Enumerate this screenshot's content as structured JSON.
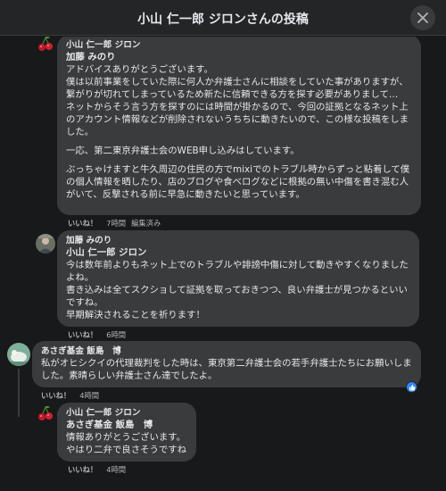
{
  "header": {
    "title": "小山 仁一郎 ジロンさんの投稿"
  },
  "comments": [
    {
      "author": "小山 仁一郎 ジロン",
      "mention": "加藤 みのり",
      "lines": [
        "アドバイスありがとうございます。",
        "僕は以前事業をしていた際に何人か弁護士さんに相談をしていた事がありますが、繋がりが切れてしまっているため新たに信頼できる方を探す必要がありまして…",
        "ネットからそう言う方を探すのには時間が掛かるので、今回の証拠となるネット上のアカウント情報などが削除されないうちちに動きたいので、この様な投稿をしました。",
        "一応、第二東京弁護士会のWEB申し込みはしています。",
        "ぶっちゃけますと牛久周辺の住民の方でmixiでのトラブル時からずっと粘着して僕の個人情報を晒したり、店のブログや食べログなどに根拠の無い中傷を書き混む人がいて、反撃される前に早急に動きたいと思っています。"
      ],
      "like": "いいね！",
      "time": "7時間",
      "edited": "編集済み"
    },
    {
      "author": "加藤 みのり",
      "mention": "小山 仁一郎 ジロン",
      "lines": [
        "今は数年前よりもネット上でのトラブルや誹謗中傷に対して動きやすくなりましたよね。",
        "書き込みは全てスクショして証拠を取っておきつつ、良い弁護士が見つかるといいですね。",
        "早期解決されることを祈ります！"
      ],
      "like": "いいね！",
      "time": "6時間"
    },
    {
      "author": "あさぎ基金 飯島　博",
      "lines": [
        "私がオヒシクイの代理裁判をした時は、東京第二弁護士会の若手弁護士たちにお願いしました。素晴らしい弁護士さん達でしたよ。"
      ],
      "like": "いいね！",
      "time": "4時間",
      "reaction_count": 1
    },
    {
      "author": "小山 仁一郎 ジロン",
      "mention": "あさぎ基金 飯島　博",
      "lines": [
        "情報ありがとうございます。",
        "やはり二弁で良さそうですね"
      ],
      "like": "いいね！",
      "time": "4時間"
    }
  ],
  "colors": {
    "background": "#18191a",
    "bubble": "#3a3b3c",
    "text": "#e4e6eb",
    "meta": "#b0b3b8",
    "like_blue": "#2d88ff"
  },
  "icons": {
    "close": "close-icon",
    "like": "thumbs-up-icon",
    "avatar_cherry": "cherry-avatar-icon",
    "avatar_user": "user-photo-icon",
    "avatar_bird": "bird-photo-icon"
  }
}
